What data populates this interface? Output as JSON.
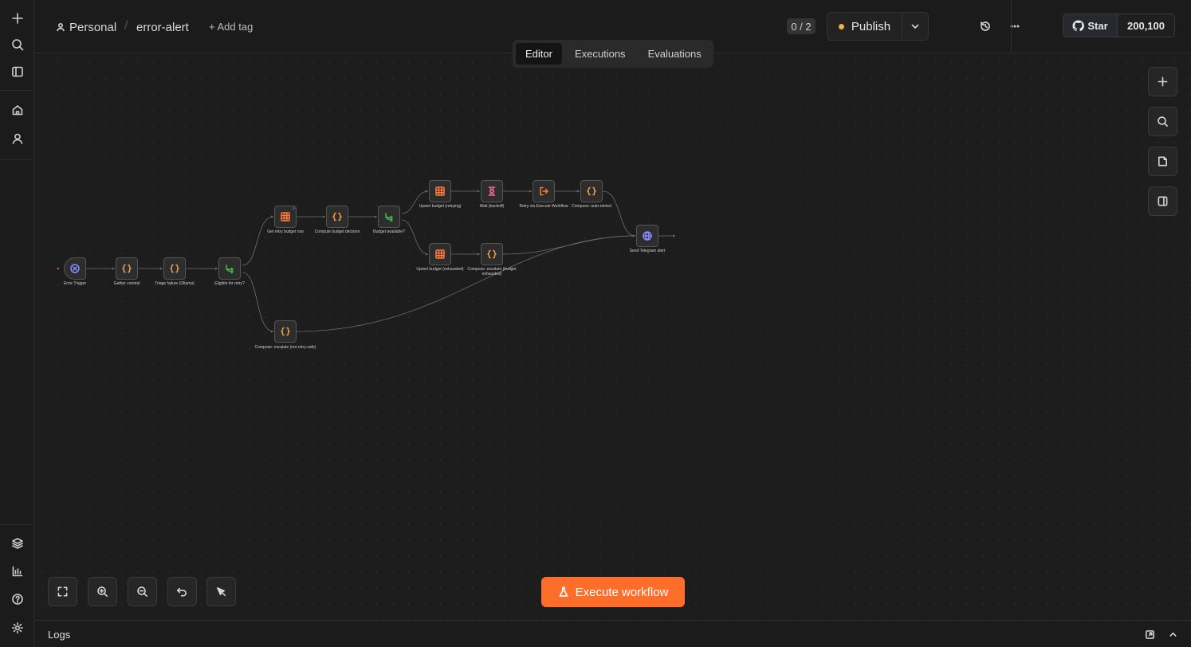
{
  "header": {
    "project": "Personal",
    "workflow_name": "error-alert",
    "add_tag": "+ Add tag",
    "counter": "0 / 2",
    "publish_label": "Publish",
    "github_star_label": "Star",
    "github_star_count": "200,100"
  },
  "tabs": [
    "Editor",
    "Executions",
    "Evaluations"
  ],
  "active_tab": "Editor",
  "nodes": {
    "error_trigger": "Error Trigger",
    "gather_context": "Gather context",
    "triage_failure": "Triage failure (Ollama)",
    "eligible_retry": "Eligible for retry?",
    "get_retry_budget": "Get retry budget row",
    "compute_budget": "Compute budget decision",
    "budget_available": "Budget available?",
    "upsert_retrying": "Upsert budget (retrying)",
    "wait_backoff": "Wait (backoff)",
    "retry_execute": "Retry via Execute Workflow",
    "compose_auto_retried": "Compose: auto-retried",
    "upsert_exhausted": "Upsert budget (exhausted)",
    "compose_escalate_exhausted": "Compose: escalate (budget exhausted)",
    "compose_escalate_not_retry": "Compose: escalate (not retry-safe)",
    "send_telegram": "Send Telegram alert"
  },
  "execute_button": "Execute workflow",
  "logs_label": "Logs",
  "colors": {
    "accent": "#ff6d2b",
    "publish_dot": "#f2b233",
    "code_node": "#f0a04b",
    "table_node": "#ff7a3d",
    "if_node": "#3fb950",
    "wait_node": "#e86a8a",
    "trigger_node": "#8a8aff",
    "http_node": "#8a8aff"
  }
}
